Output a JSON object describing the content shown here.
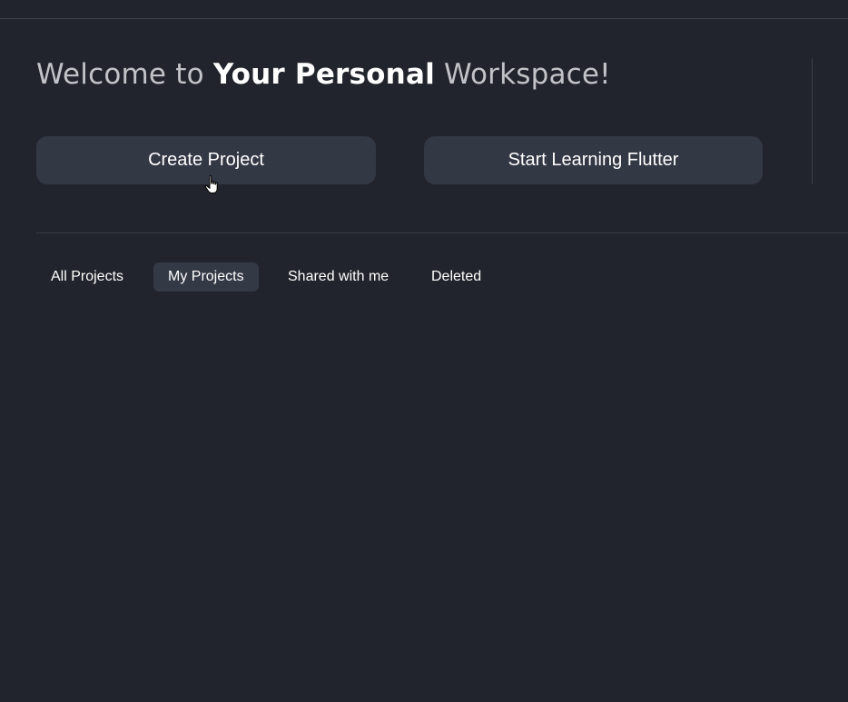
{
  "header": {
    "welcome_prefix": "Welcome to ",
    "welcome_emphasis": "Your Personal",
    "welcome_suffix": " Workspace!"
  },
  "actions": {
    "create_project": "Create Project",
    "start_learning": "Start Learning Flutter"
  },
  "tabs": [
    {
      "label": "All Projects",
      "active": false
    },
    {
      "label": "My Projects",
      "active": true
    },
    {
      "label": "Shared with me",
      "active": false
    },
    {
      "label": "Deleted",
      "active": false
    }
  ],
  "cursor": {
    "icon": "hand-pointer-cursor-icon"
  },
  "colors": {
    "background": "#21242c",
    "button": "#333845",
    "active_tab": "#343946",
    "divider": "#3a3e48",
    "muted_text": "#c2c3c8",
    "text": "#ffffff"
  }
}
